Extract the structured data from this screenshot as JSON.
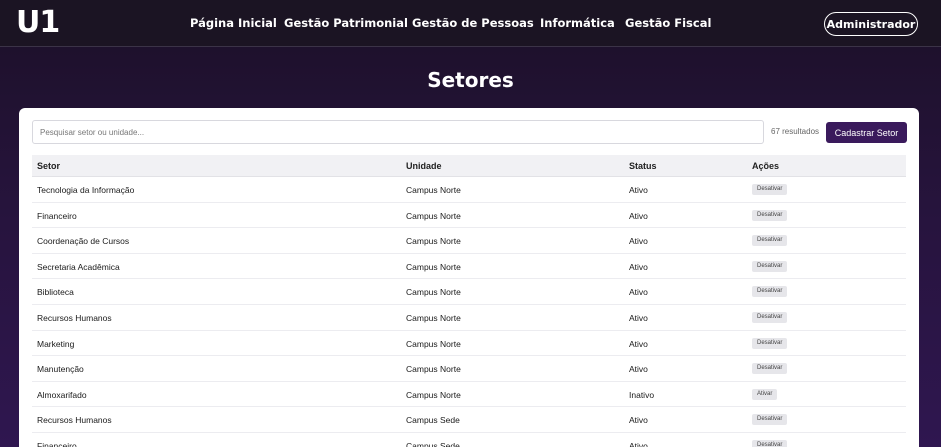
{
  "header": {
    "logo": "U1",
    "nav": [
      {
        "label": "Página Inicial"
      },
      {
        "label": "Gestão Patrimonial"
      },
      {
        "label": "Gestão de Pessoas"
      },
      {
        "label": "Informática"
      },
      {
        "label": "Gestão Fiscal"
      }
    ],
    "user_button": "Administrador"
  },
  "page": {
    "title": "Setores"
  },
  "toolbar": {
    "search_placeholder": "Pesquisar setor ou unidade...",
    "results_count": "67 resultados",
    "add_button": "Cadastrar Setor"
  },
  "table": {
    "columns": [
      "Setor",
      "Unidade",
      "Status",
      "Ações"
    ],
    "rows": [
      {
        "setor": "Tecnologia da Informação",
        "unidade": "Campus Norte",
        "status": "Ativo",
        "acao": "Desativar"
      },
      {
        "setor": "Financeiro",
        "unidade": "Campus Norte",
        "status": "Ativo",
        "acao": "Desativar"
      },
      {
        "setor": "Coordenação de Cursos",
        "unidade": "Campus Norte",
        "status": "Ativo",
        "acao": "Desativar"
      },
      {
        "setor": "Secretaria Acadêmica",
        "unidade": "Campus Norte",
        "status": "Ativo",
        "acao": "Desativar"
      },
      {
        "setor": "Biblioteca",
        "unidade": "Campus Norte",
        "status": "Ativo",
        "acao": "Desativar"
      },
      {
        "setor": "Recursos Humanos",
        "unidade": "Campus Norte",
        "status": "Ativo",
        "acao": "Desativar"
      },
      {
        "setor": "Marketing",
        "unidade": "Campus Norte",
        "status": "Ativo",
        "acao": "Desativar"
      },
      {
        "setor": "Manutenção",
        "unidade": "Campus Norte",
        "status": "Ativo",
        "acao": "Desativar"
      },
      {
        "setor": "Almoxarifado",
        "unidade": "Campus Norte",
        "status": "Inativo",
        "acao": "Ativar"
      },
      {
        "setor": "Recursos Humanos",
        "unidade": "Campus Sede",
        "status": "Ativo",
        "acao": "Desativar"
      },
      {
        "setor": "Financeiro",
        "unidade": "Campus Sede",
        "status": "Ativo",
        "acao": "Desativar"
      }
    ]
  },
  "colors": {
    "header_bg": "#1b1423",
    "page_bg": "#27143e",
    "accent": "#3a1a5c",
    "card_bg": "#ffffff"
  }
}
